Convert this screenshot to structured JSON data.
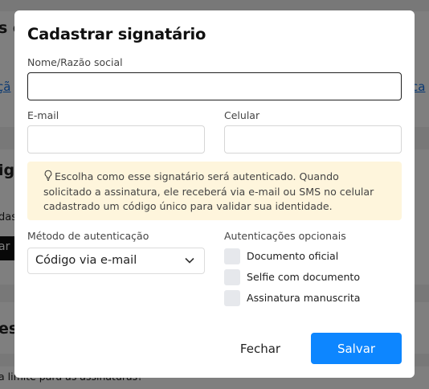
{
  "background": {
    "fragment_heading": "s c",
    "link_left": "çã",
    "link_right": "ca",
    "fragment_section": "ig",
    "fragment_das": "das",
    "fragment_button": "ar",
    "fragment_es": "es",
    "fragment_bottom": "a limite para as assinaturas?"
  },
  "modal": {
    "title": "Cadastrar signatário",
    "name_label": "Nome/Razão social",
    "name_value": "",
    "email_label": "E-mail",
    "email_value": "",
    "phone_label": "Celular",
    "phone_value": "",
    "notice_text": "Escolha como esse signatário será autenticado. Quando solicitado a assinatura, ele receberá via e-mail ou SMS no celular cadastrado um código único para validar sua identidade.",
    "auth_method_label": "Método de autenticação",
    "auth_method_value": "Código via e-mail",
    "optional_auth_label": "Autenticações opcionais",
    "optional_auth": [
      {
        "label": "Documento oficial",
        "checked": false
      },
      {
        "label": "Selfie com documento",
        "checked": false
      },
      {
        "label": "Assinatura manuscrita",
        "checked": false
      }
    ],
    "close_button": "Fechar",
    "save_button": "Salvar"
  },
  "colors": {
    "primary": "#0d86ff",
    "notice_background": "#fef5dc",
    "checkbox_background": "#e6e8ec",
    "overlay": "rgba(0,0,0,0.5)"
  },
  "icons": {
    "notice": "lightbulb-icon",
    "select": "chevron-down-icon"
  }
}
